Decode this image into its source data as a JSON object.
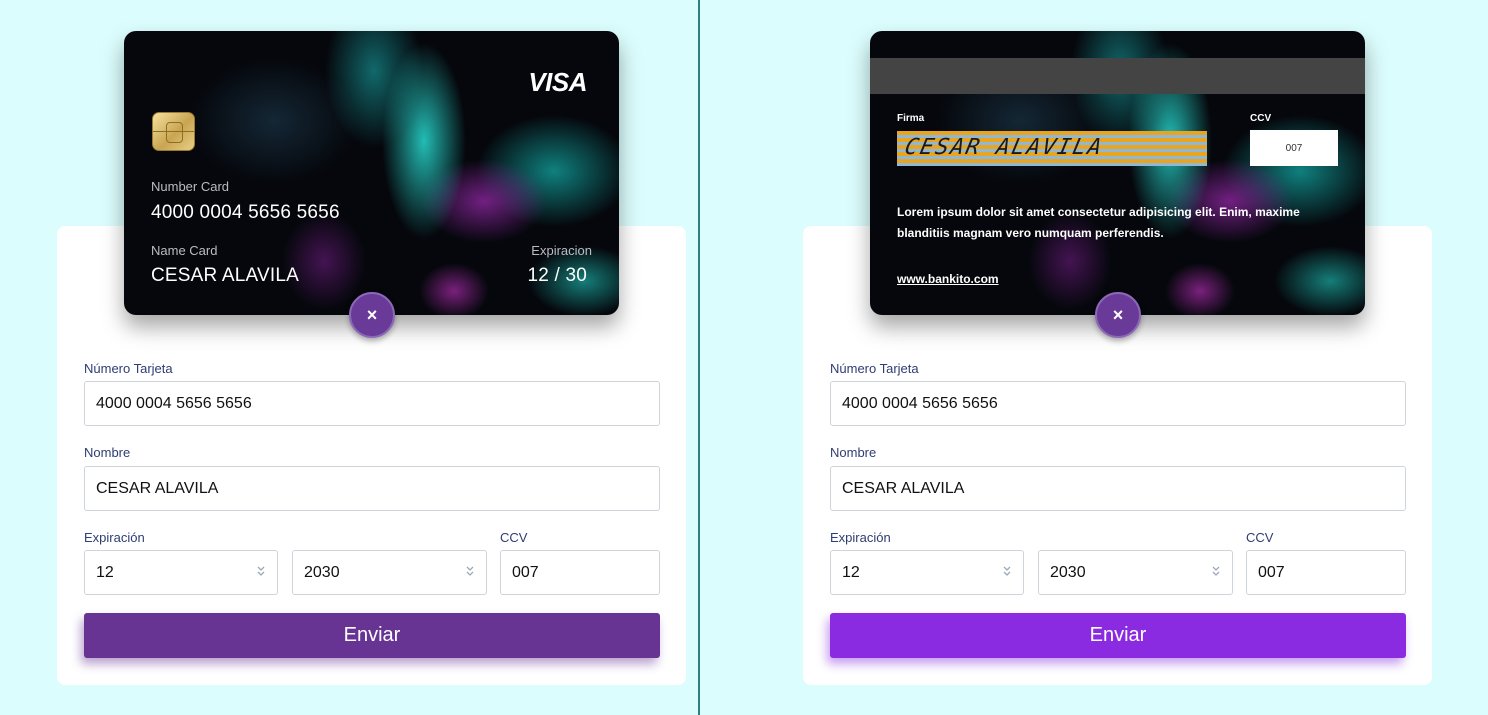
{
  "colors": {
    "page_background": "#dcfdfd",
    "close_button": "#6a3a99",
    "submit_button_left": "#673494",
    "submit_button_right": "#8a2be2",
    "label_text": "#2e3d73"
  },
  "icons": {
    "chip": "card-chip-icon",
    "close": "close-icon",
    "select_chevron": "chevron-double-down-icon"
  },
  "card_front": {
    "brand": "VISA",
    "number_label": "Number Card",
    "number": "4000 0004 5656 5656",
    "name_label": "Name Card",
    "name": "CESAR ALAVILA",
    "expiry_label": "Expiracion",
    "expiry": "12 / 30"
  },
  "card_back": {
    "signature_label": "Firma",
    "signature": "CESAR ALAVILA",
    "ccv_label": "CCV",
    "ccv": "007",
    "text": "Lorem ipsum dolor sit amet consectetur adipisicing elit. Enim, maxime blanditiis magnam vero numquam perferendis.",
    "link": "www.bankito.com"
  },
  "close_button": {
    "label": "×"
  },
  "form": {
    "card_number_label": "Número Tarjeta",
    "card_number_value": "4000 0004 5656 5656",
    "name_label": "Nombre",
    "name_value": "CESAR ALAVILA",
    "expiry_label": "Expiración",
    "month_value": "12",
    "year_value": "2030",
    "ccv_label": "CCV",
    "ccv_value": "007",
    "submit_label": "Enviar"
  }
}
